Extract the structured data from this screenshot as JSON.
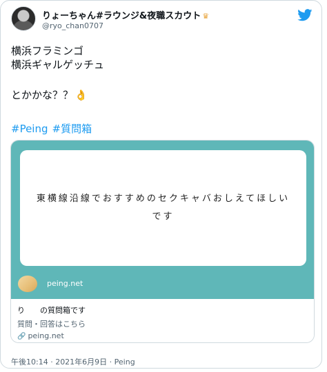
{
  "author": {
    "name": "りょーちゃん#ラウンジ&夜職スカウト",
    "name_badge_icon": "crown-icon",
    "handle": "@ryo_chan0707"
  },
  "tweet": {
    "lines": [
      "横浜フラミンゴ",
      "横浜ギャルゲッチュ",
      "",
      "とかかな？？"
    ],
    "emoji_icon": "ok-hand-icon",
    "hashtags": [
      "#Peing",
      "#質問箱"
    ]
  },
  "card": {
    "question_text": "東横線沿線でおすすめのセクキャバおしえてほしいです",
    "site_domain": "peing.net",
    "title": "り　　の質問箱です",
    "description": "質問・回答はこちら",
    "link_text": "peing.net"
  },
  "meta": {
    "timestamp": "午後10:14 · 2021年6月9日 · Peing"
  },
  "colors": {
    "card_teal": "#5fb7b8",
    "link_blue": "#1d9bf0",
    "twitter_blue": "#1d9bf0"
  }
}
